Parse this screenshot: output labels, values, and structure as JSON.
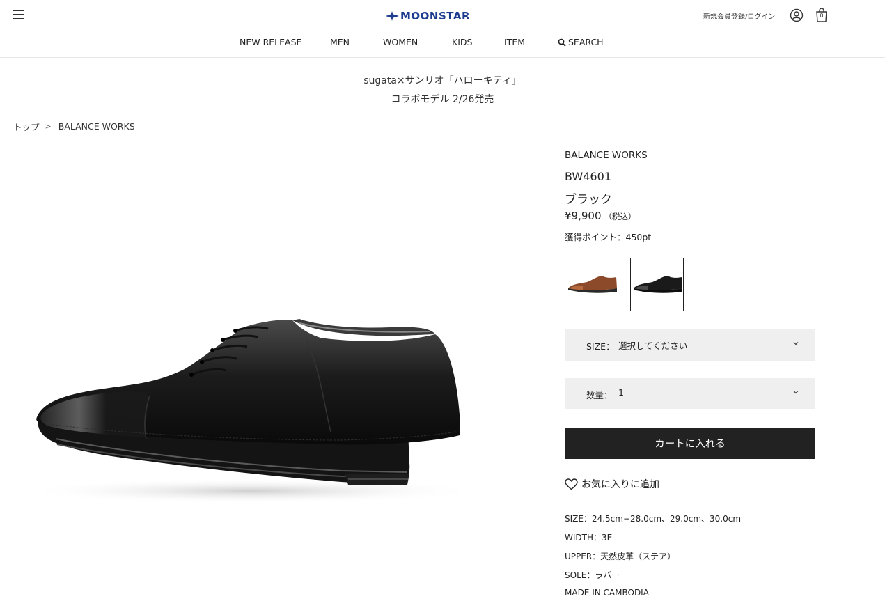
{
  "header": {
    "logo_text": "MOONSTAR",
    "login_label": "新規会員登録/ログイン",
    "cart_count": "0"
  },
  "nav": {
    "items": [
      "NEW RELEASE",
      "MEN",
      "WOMEN",
      "KIDS",
      "ITEM"
    ],
    "search_label": "SEARCH"
  },
  "banner": {
    "line1": "sugata×サンリオ「ハローキティ」",
    "line2": "コラボモデル 2/26発売"
  },
  "breadcrumb": {
    "home": "トップ",
    "separator": ">",
    "current": "BALANCE WORKS"
  },
  "product": {
    "brand": "BALANCE WORKS",
    "model": "BW4601",
    "color": "ブラック",
    "price": "¥9,900",
    "price_tax": "（税込）",
    "points": "獲得ポイント：450pt",
    "swatches": [
      "brown",
      "black"
    ],
    "selected_swatch": "black"
  },
  "options": {
    "size_label": "SIZE：",
    "size_value": "選択してください",
    "qty_label": "数量：",
    "qty_value": "1"
  },
  "actions": {
    "add_to_cart": "カートに入れる",
    "favorite": "お気に入りに追加"
  },
  "specs": [
    "SIZE：24.5cm−28.0cm、29.0cm、30.0cm",
    "WIDTH：3E",
    "UPPER：天然皮革（ステア）",
    "SOLE：ラバー",
    "MADE IN CAMBODIA"
  ],
  "colors": {
    "brand_blue": "#1d3c8f",
    "cart_button": "#222222",
    "select_bg": "#efefef"
  }
}
